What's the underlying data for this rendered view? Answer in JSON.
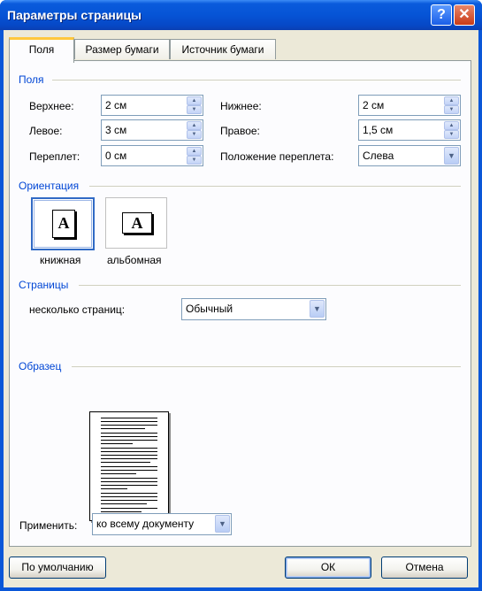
{
  "window": {
    "title": "Параметры страницы",
    "help_glyph": "?",
    "close_glyph": "✕"
  },
  "tabs": [
    {
      "label": "Поля",
      "active": true
    },
    {
      "label": "Размер бумаги",
      "active": false
    },
    {
      "label": "Источник бумаги",
      "active": false
    }
  ],
  "margins": {
    "group_label": "Поля",
    "top": {
      "label": "Верхнее:",
      "value": "2 см"
    },
    "bottom": {
      "label": "Нижнее:",
      "value": "2 см"
    },
    "left": {
      "label": "Левое:",
      "value": "3 см"
    },
    "right": {
      "label": "Правое:",
      "value": "1,5 см"
    },
    "gutter": {
      "label": "Переплет:",
      "value": "0 см"
    },
    "gutter_position": {
      "label": "Положение переплета:",
      "value": "Слева"
    }
  },
  "orientation": {
    "group_label": "Ориентация",
    "portrait": {
      "label": "книжная",
      "glyph": "A",
      "selected": true
    },
    "landscape": {
      "label": "альбомная",
      "glyph": "A",
      "selected": false
    }
  },
  "pages": {
    "group_label": "Страницы",
    "multiple_label": "несколько страниц:",
    "multiple_value": "Обычный"
  },
  "preview": {
    "group_label": "Образец",
    "apply_label": "Применить:",
    "apply_value": "ко всему документу"
  },
  "buttons": {
    "default": "По умолчанию",
    "ok": "ОК",
    "cancel": "Отмена"
  },
  "colors": {
    "titlebar": "#0a5bdc",
    "group_label": "#0046d5",
    "dialog_bg": "#ece9d8"
  }
}
